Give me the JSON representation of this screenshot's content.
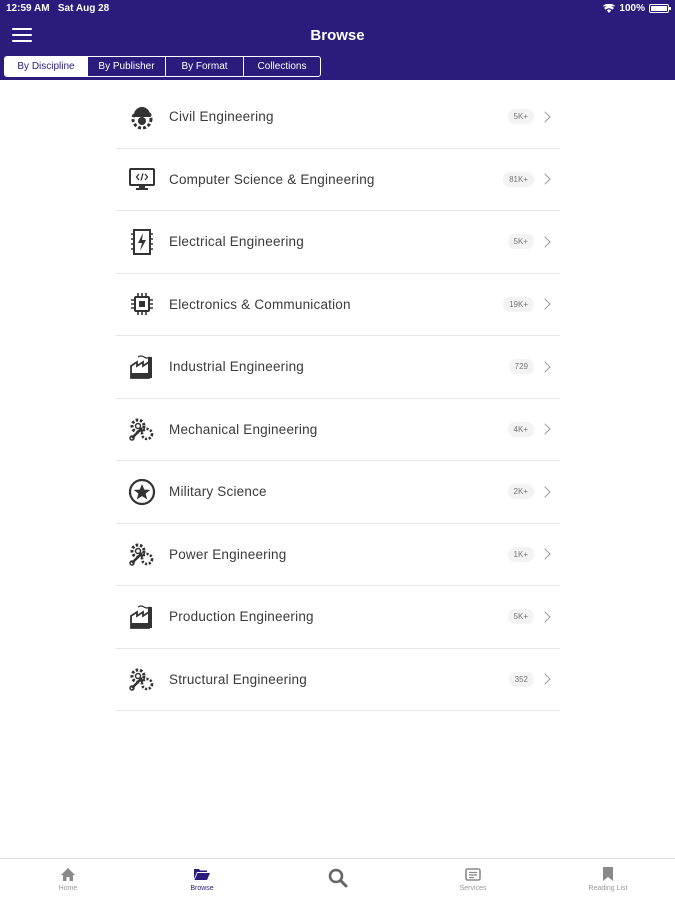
{
  "status": {
    "time": "12:59 AM",
    "date": "Sat Aug 28",
    "battery": "100%"
  },
  "header": {
    "title": "Browse"
  },
  "segments": [
    "By Discipline",
    "By Publisher",
    "By Format",
    "Collections"
  ],
  "list": [
    {
      "label": "Civil Engineering",
      "count": "5K+",
      "icon": "hardhat-gear-icon"
    },
    {
      "label": "Computer Science & Engineering",
      "count": "81K+",
      "icon": "monitor-code-icon"
    },
    {
      "label": "Electrical Engineering",
      "count": "5K+",
      "icon": "electric-icon"
    },
    {
      "label": "Electronics & Communication",
      "count": "19K+",
      "icon": "chip-icon"
    },
    {
      "label": "Industrial Engineering",
      "count": "729",
      "icon": "factory-icon"
    },
    {
      "label": "Mechanical Engineering",
      "count": "4K+",
      "icon": "gears-wrench-icon"
    },
    {
      "label": "Military Science",
      "count": "2K+",
      "icon": "star-badge-icon"
    },
    {
      "label": "Power Engineering",
      "count": "1K+",
      "icon": "gears-wrench-icon"
    },
    {
      "label": "Production Engineering",
      "count": "5K+",
      "icon": "factory-icon"
    },
    {
      "label": "Structural Engineering",
      "count": "352",
      "icon": "gears-wrench-icon"
    }
  ],
  "tabs": [
    {
      "label": "Home",
      "icon": "home-icon"
    },
    {
      "label": "Browse",
      "icon": "folder-open-icon"
    },
    {
      "label": "",
      "icon": "search-icon"
    },
    {
      "label": "Services",
      "icon": "services-icon"
    },
    {
      "label": "Reading List",
      "icon": "bookmark-icon"
    }
  ],
  "colors": {
    "brand": "#2b1b7c"
  }
}
